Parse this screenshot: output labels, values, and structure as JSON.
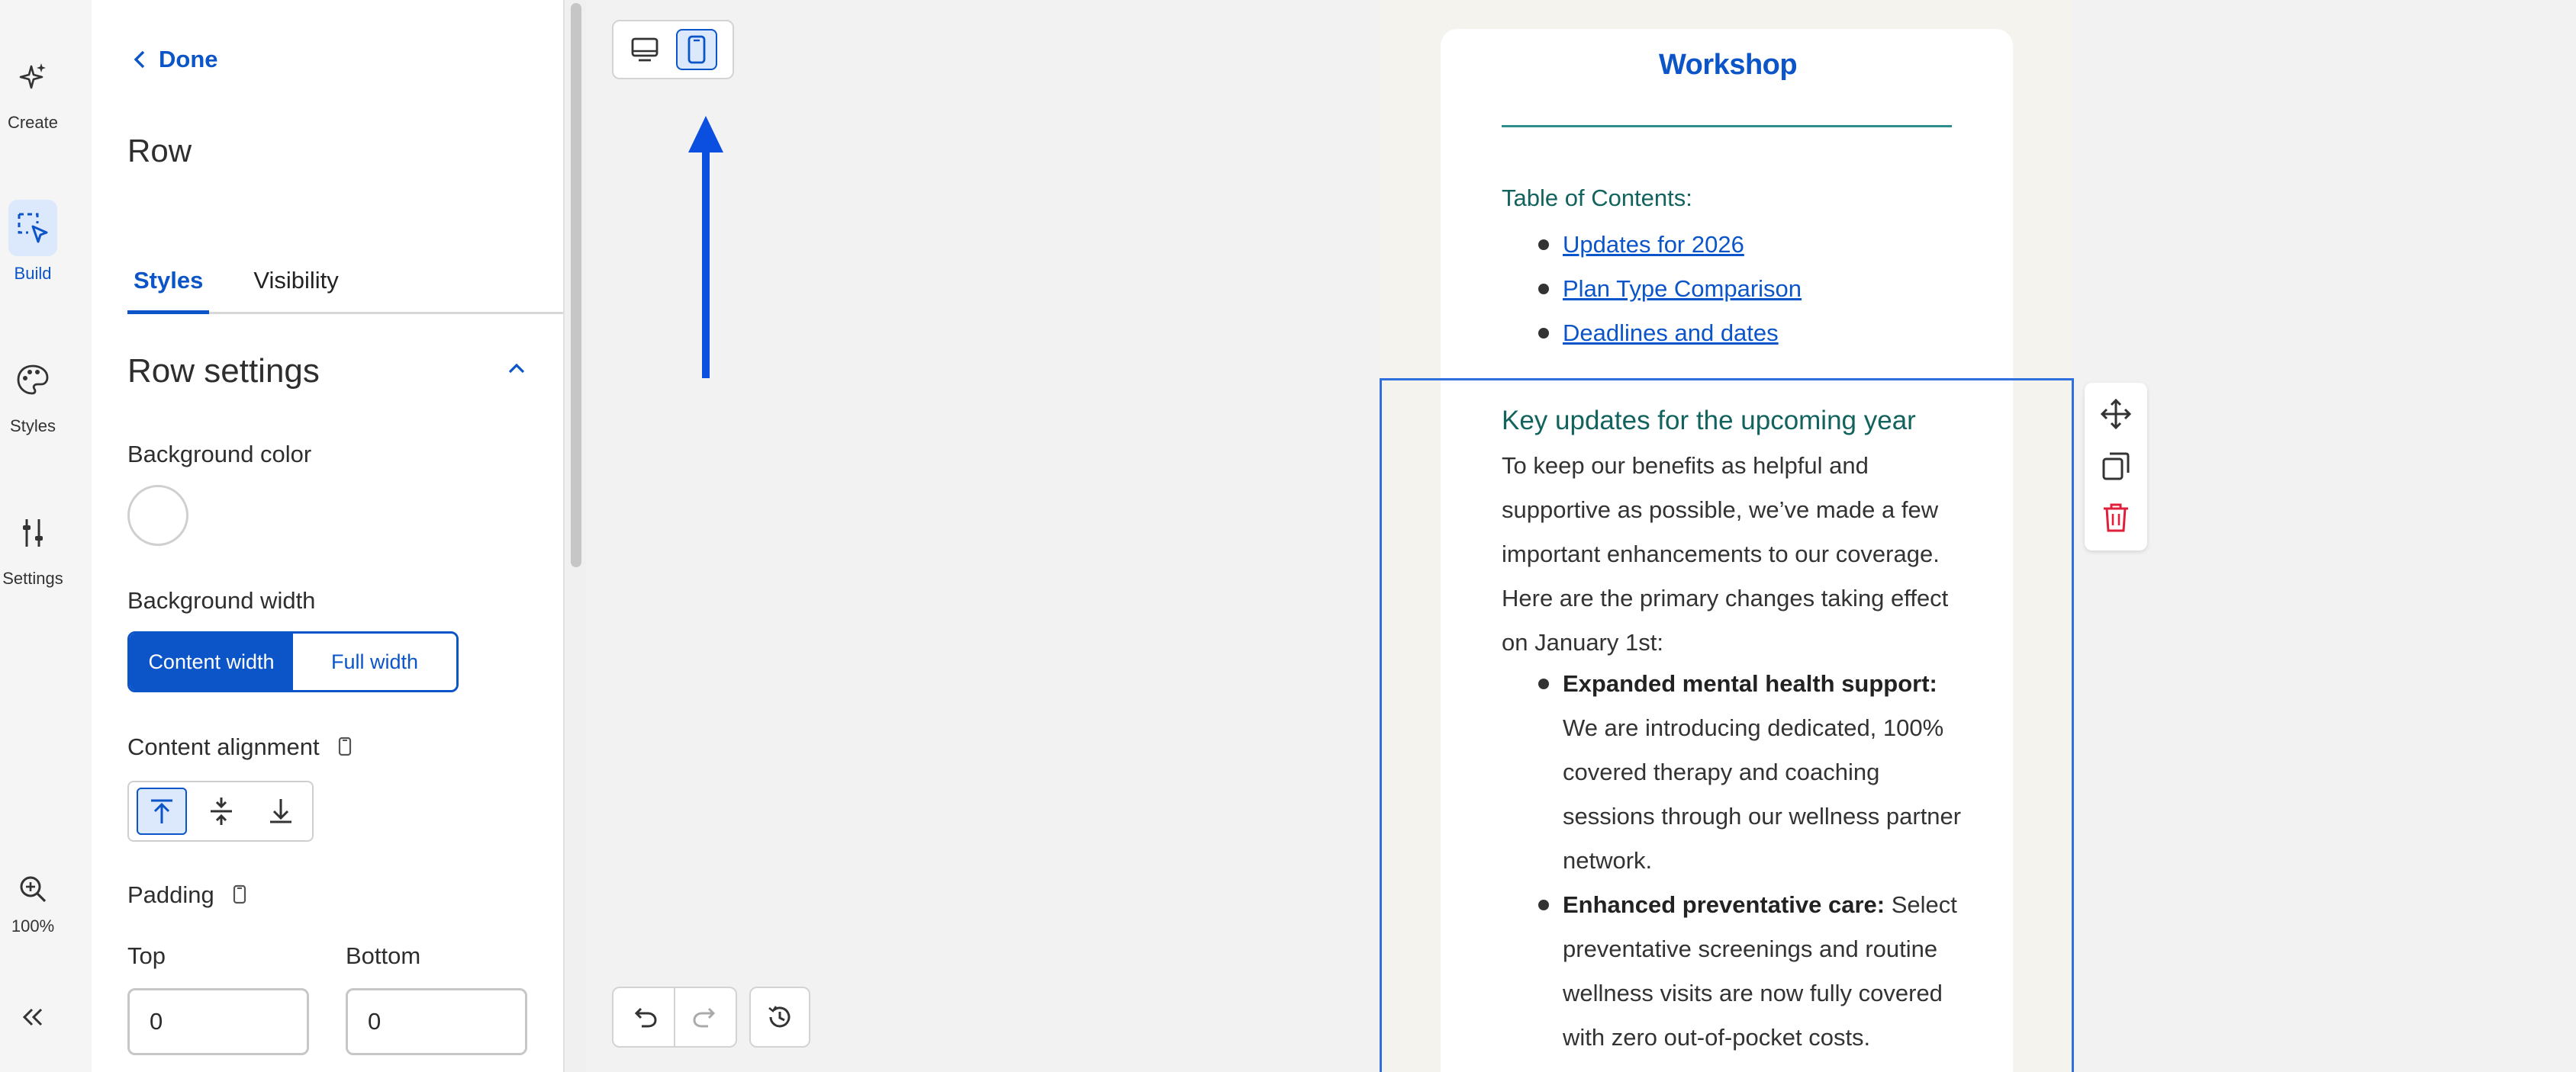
{
  "rail": {
    "items": [
      {
        "label": "Create",
        "icon": "sparkle-icon"
      },
      {
        "label": "Build",
        "icon": "build-select-icon",
        "active": true
      },
      {
        "label": "Styles",
        "icon": "palette-icon"
      },
      {
        "label": "Settings",
        "icon": "sliders-icon"
      }
    ],
    "zoom_label": "100%",
    "zoom_icon": "zoom-in-icon",
    "collapse_icon": "double-chevron-left-icon"
  },
  "panel": {
    "done_label": "Done",
    "title": "Row",
    "tabs": [
      {
        "label": "Styles",
        "active": true
      },
      {
        "label": "Visibility",
        "active": false
      }
    ],
    "section_title": "Row settings",
    "background_color_label": "Background color",
    "background_width_label": "Background width",
    "background_width_options": [
      "Content width",
      "Full width"
    ],
    "background_width_selected": "Content width",
    "content_alignment_label": "Content alignment",
    "content_alignment_selected": "top",
    "padding_label": "Padding",
    "padding_top_label": "Top",
    "padding_bottom_label": "Bottom",
    "padding_top_value": "0",
    "padding_bottom_value": "0"
  },
  "canvas": {
    "view_mode_selected": "mobile",
    "accent_color": "#0b55c8",
    "annotation_arrow_color": "#0b4fe0"
  },
  "email": {
    "logo_text": "Workshop",
    "toc_title": "Table of Contents:",
    "toc_links": [
      "Updates for 2026",
      "Plan Type Comparison",
      "Deadlines and dates"
    ],
    "section_heading": "Key updates for the upcoming year",
    "section_body": "To keep our benefits as helpful and supportive as possible, we’ve made a few important enhancements to our coverage. Here are the primary changes taking effect on January 1st:",
    "list": [
      {
        "bold": "Expanded mental health support:",
        "text": " We are introducing dedicated, 100% covered therapy and coaching sessions through our wellness partner network."
      },
      {
        "bold": "Enhanced preventative care:",
        "text": " Select preventative screenings and routine wellness visits are now fully covered with zero out-of-pocket costs."
      }
    ],
    "heading_color": "#12635e"
  },
  "row_tools": {
    "move_icon": "move-arrows-icon",
    "duplicate_icon": "duplicate-icon",
    "delete_icon": "trash-icon",
    "delete_color": "#e0203a"
  }
}
